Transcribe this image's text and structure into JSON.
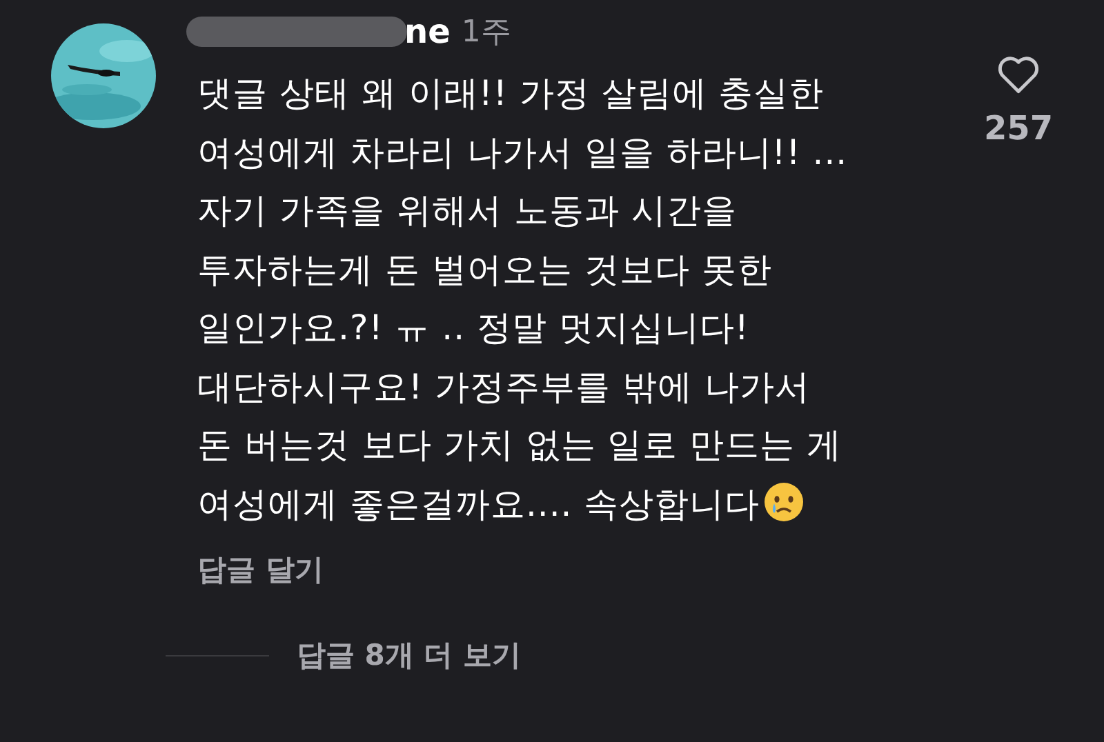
{
  "comment": {
    "username": "ne",
    "time": "1주",
    "text": "댓글 상태 왜 이래!! 가정 살림에 충실한\n여성에게 차라리 나가서 일을 하라니!! ...\n자기 가족을 위해서 노동과 시간을\n투자하는게 돈 벌어오는 것보다 못한\n일인가요.?! ㅠ .. 정말 멋지십니다!\n대단하시구요! 가정주부를 밖에 나가서\n돈 버는것 보다 가치 없는 일로 만드는 게\n여성에게 좋은걸까요.... 속상합니다",
    "reply_label": "답글 달기",
    "like_count": "257",
    "liked": false
  },
  "more_replies": "답글 8개 더 보기"
}
